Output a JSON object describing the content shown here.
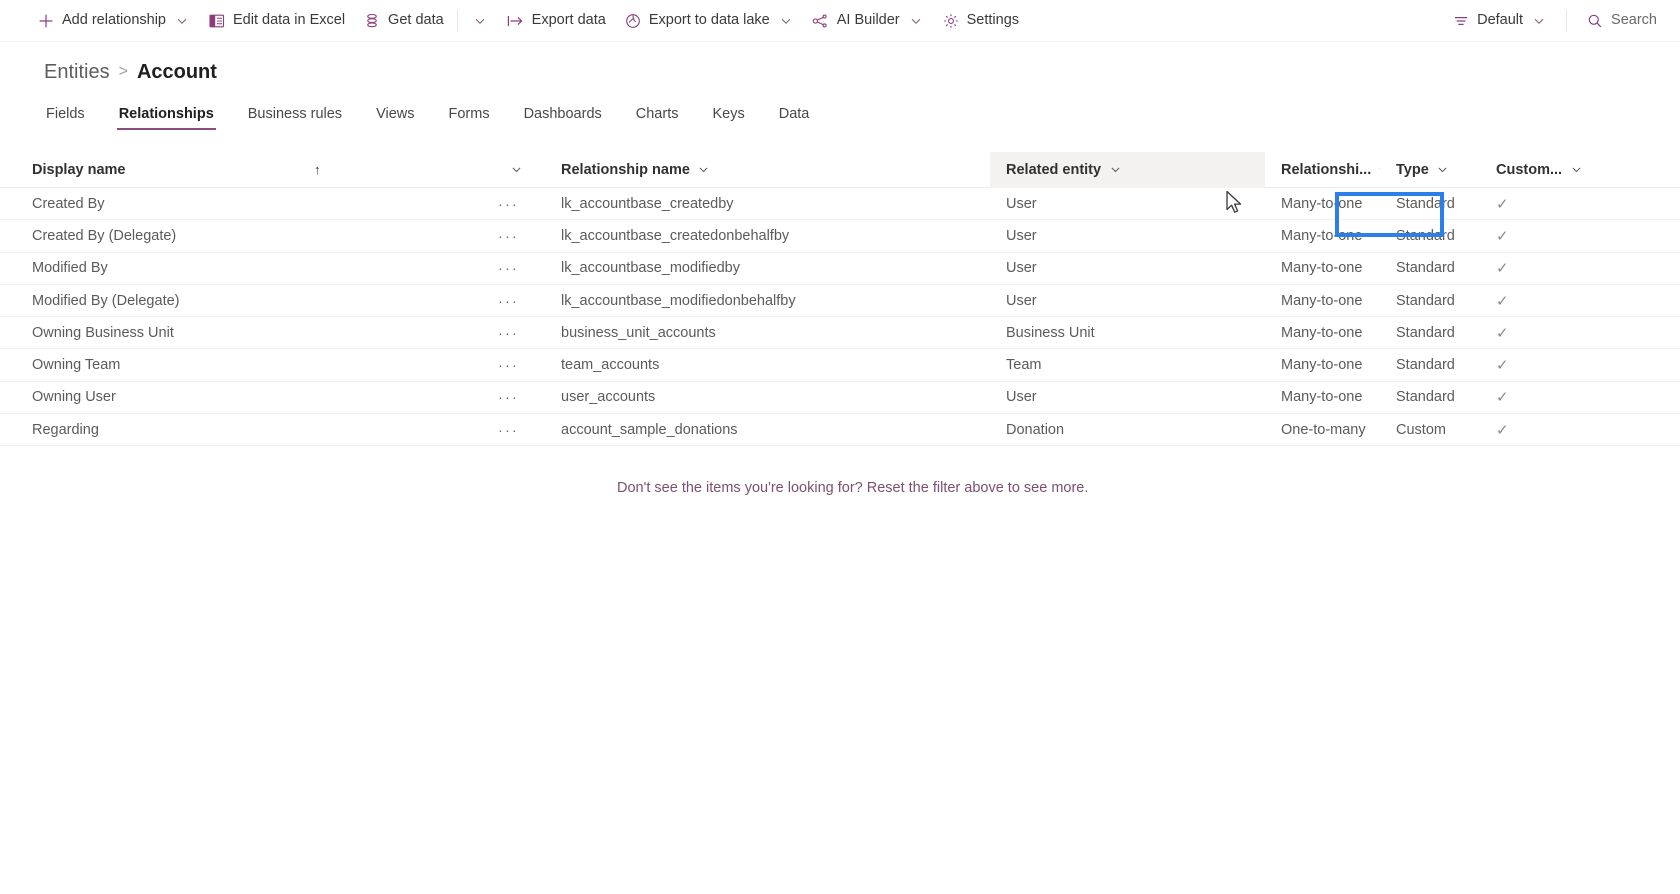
{
  "commandbar": {
    "items": [
      {
        "label": "Add relationship",
        "icon": "plus-icon",
        "has_chevron": true
      },
      {
        "label": "Edit data in Excel",
        "icon": "excel-icon",
        "has_chevron": false
      },
      {
        "label": "Get data",
        "icon": "database-icon",
        "has_chevron": false
      },
      {
        "label": "",
        "icon": "chevron-down-icon",
        "has_chevron": false
      },
      {
        "label": "Export data",
        "icon": "export-icon",
        "has_chevron": false
      },
      {
        "label": "Export to data lake",
        "icon": "data-lake-icon",
        "has_chevron": true
      },
      {
        "label": "AI Builder",
        "icon": "ai-builder-icon",
        "has_chevron": true
      },
      {
        "label": "Settings",
        "icon": "gear-icon",
        "has_chevron": false
      }
    ],
    "view_selector": {
      "label": "Default",
      "icon": "filter-lines-icon"
    },
    "search": {
      "label": "Search",
      "icon": "search-icon",
      "placeholder": "Search"
    }
  },
  "breadcrumb": {
    "parent": "Entities",
    "separator": ">",
    "current": "Account"
  },
  "tabs": [
    {
      "label": "Fields",
      "active": false
    },
    {
      "label": "Relationships",
      "active": true
    },
    {
      "label": "Business rules",
      "active": false
    },
    {
      "label": "Views",
      "active": false
    },
    {
      "label": "Forms",
      "active": false
    },
    {
      "label": "Dashboards",
      "active": false
    },
    {
      "label": "Charts",
      "active": false
    },
    {
      "label": "Keys",
      "active": false
    },
    {
      "label": "Data",
      "active": false
    }
  ],
  "grid": {
    "columns": [
      {
        "label": "Display name",
        "sort": "↑",
        "hovered": false
      },
      {
        "label": "Relationship name",
        "sort": "",
        "hovered": false
      },
      {
        "label": "Related entity",
        "sort": "",
        "hovered": true
      },
      {
        "label": "Relationshi...",
        "sort": "",
        "hovered": false
      },
      {
        "label": "Type",
        "sort": "",
        "hovered": false
      },
      {
        "label": "Custom...",
        "sort": "",
        "hovered": false
      }
    ],
    "row_menu_glyph": "···",
    "checkmark_glyph": "✓",
    "rows": [
      {
        "display_name": "Created By",
        "relationship_name": "lk_accountbase_createdby",
        "related_entity": "User",
        "relationship_type": "Many-to-one",
        "type": "Standard",
        "custom": true
      },
      {
        "display_name": "Created By (Delegate)",
        "relationship_name": "lk_accountbase_createdonbehalfby",
        "related_entity": "User",
        "relationship_type": "Many-to-one",
        "type": "Standard",
        "custom": true
      },
      {
        "display_name": "Modified By",
        "relationship_name": "lk_accountbase_modifiedby",
        "related_entity": "User",
        "relationship_type": "Many-to-one",
        "type": "Standard",
        "custom": true
      },
      {
        "display_name": "Modified By (Delegate)",
        "relationship_name": "lk_accountbase_modifiedonbehalfby",
        "related_entity": "User",
        "relationship_type": "Many-to-one",
        "type": "Standard",
        "custom": true
      },
      {
        "display_name": "Owning Business Unit",
        "relationship_name": "business_unit_accounts",
        "related_entity": "Business Unit",
        "relationship_type": "Many-to-one",
        "type": "Standard",
        "custom": true
      },
      {
        "display_name": "Owning Team",
        "relationship_name": "team_accounts",
        "related_entity": "Team",
        "relationship_type": "Many-to-one",
        "type": "Standard",
        "custom": true
      },
      {
        "display_name": "Owning User",
        "relationship_name": "user_accounts",
        "related_entity": "User",
        "relationship_type": "Many-to-one",
        "type": "Standard",
        "custom": true
      },
      {
        "display_name": "Regarding",
        "relationship_name": "account_sample_donations",
        "related_entity": "Donation",
        "relationship_type": "One-to-many",
        "type": "Custom",
        "custom": true
      }
    ]
  },
  "footer_message": "Don't see the items you're looking for? Reset the filter above to see more.",
  "selection": {
    "highlighted_cell_value": "Many-to-one",
    "highlight_color": "#2b7fe8"
  },
  "colors": {
    "accent_purple": "#8c3c7c",
    "tab_underline": "#8b4f7f",
    "link_purple": "#7d4f70"
  }
}
